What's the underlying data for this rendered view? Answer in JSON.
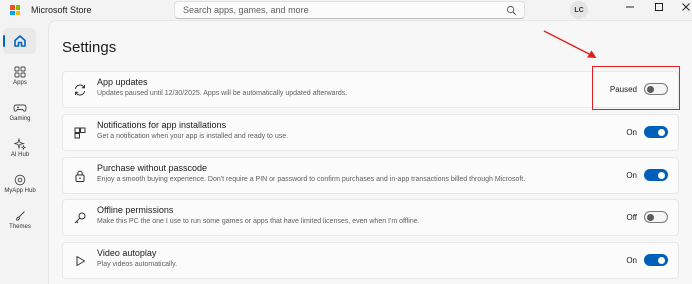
{
  "window": {
    "app_title": "Microsoft Store",
    "search_placeholder": "Search apps, games, and more",
    "avatar_initials": "LC"
  },
  "sidebar": {
    "items": [
      {
        "label": "",
        "icon": "home-icon",
        "selected": true
      },
      {
        "label": "Apps",
        "icon": "apps-icon"
      },
      {
        "label": "Gaming",
        "icon": "gamepad-icon"
      },
      {
        "label": "AI Hub",
        "icon": "sparkle-icon"
      },
      {
        "label": "MyApp Hub",
        "icon": "hub-icon"
      },
      {
        "label": "Themes",
        "icon": "brush-icon"
      }
    ]
  },
  "page": {
    "title": "Settings"
  },
  "settings": [
    {
      "title": "App updates",
      "description": "Updates paused until 12/30/2025. Apps will be automatically updated afterwards.",
      "state": "Paused",
      "on": false,
      "icon": "refresh-icon"
    },
    {
      "title": "Notifications for app installations",
      "description": "Get a notification when your app is installed and ready to use.",
      "state": "On",
      "on": true,
      "icon": "apps-notification-icon"
    },
    {
      "title": "Purchase without passcode",
      "description": "Enjoy a smooth buying experience. Don't require a PIN or password to confirm purchases and in-app transactions billed through Microsoft.",
      "state": "On",
      "on": true,
      "icon": "lock-icon"
    },
    {
      "title": "Offline permissions",
      "description": "Make this PC the one I use to run some games or apps that have limited licenses, even when I'm offline.",
      "state": "Off",
      "on": false,
      "icon": "key-icon"
    },
    {
      "title": "Video autoplay",
      "description": "Play videos automatically.",
      "state": "On",
      "on": true,
      "icon": "play-icon"
    }
  ],
  "colors": {
    "accent": "#005fb8",
    "annotation": "#e02020"
  }
}
